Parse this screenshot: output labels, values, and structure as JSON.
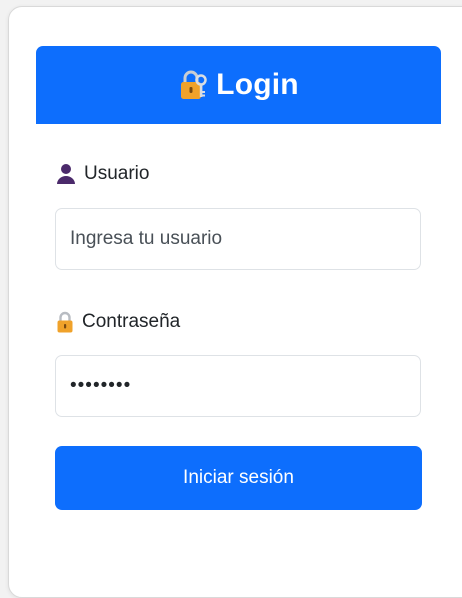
{
  "header": {
    "icon": "lock-with-key-icon",
    "title": "Login"
  },
  "form": {
    "username": {
      "icon": "user-silhouette-icon",
      "label": "Usuario",
      "placeholder": "Ingresa tu usuario",
      "value": ""
    },
    "password": {
      "icon": "padlock-icon",
      "label": "Contraseña",
      "value": "••••••••"
    },
    "submit_label": "Iniciar sesión"
  },
  "colors": {
    "primary": "#0d6efd",
    "user_icon": "#4b2a6b",
    "lock_icon": "#f0a22a"
  }
}
